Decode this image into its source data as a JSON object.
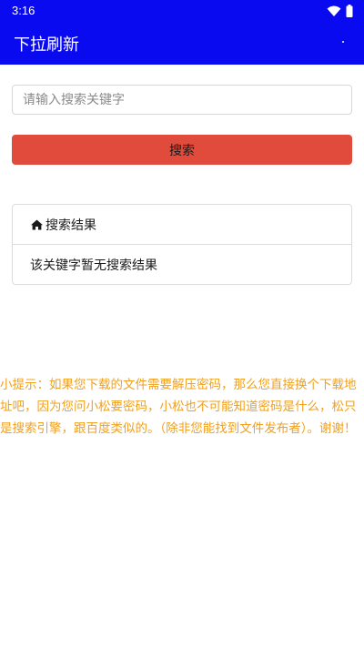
{
  "status_bar": {
    "time": "3:16",
    "icons": [
      "wifi-icon",
      "battery-icon"
    ]
  },
  "app_bar": {
    "title": "下拉刷新",
    "menu_label": "."
  },
  "search": {
    "placeholder": "请输入搜索关键字",
    "value": "",
    "button_label": "搜索"
  },
  "results": {
    "header_icon": "home-icon",
    "header_label": "搜索结果",
    "empty_message": "该关键字暂无搜索结果"
  },
  "tip": {
    "text": "小提示：如果您下载的文件需要解压密码，那么您直接换个下载地址吧，因为您问小松要密码，小松也不可能知道密码是什么，松只是搜索引擎，跟百度类似的。（除非您能找到文件发布者）。谢谢！"
  },
  "colors": {
    "primary": "#0a0af0",
    "accent": "#e04b3b",
    "tip": "#f0a01e"
  }
}
